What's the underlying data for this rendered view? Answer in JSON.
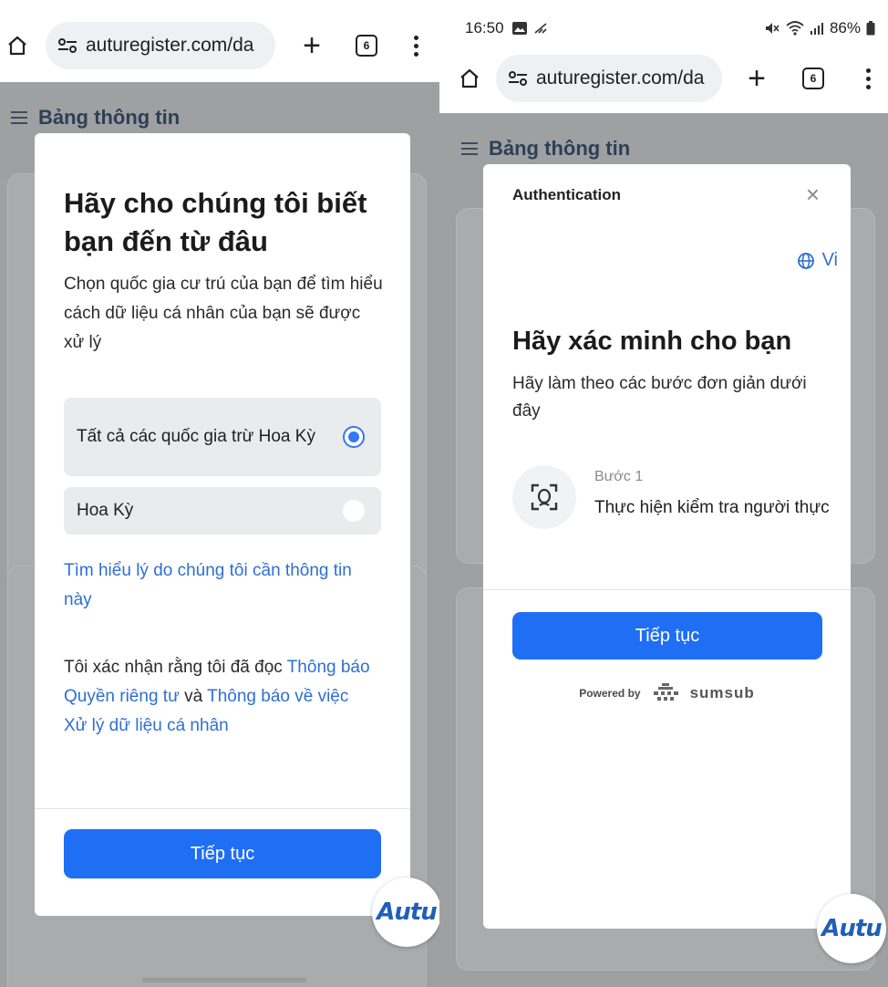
{
  "left": {
    "browser": {
      "url": "auturegister.com/da",
      "tab_count": "6"
    },
    "dashboard_title": "Bảng thông tin",
    "modal": {
      "title": "Hãy cho chúng tôi biết bạn đến từ đâu",
      "description": "Chọn quốc gia cư trú của bạn để tìm hiểu cách dữ liệu cá nhân của bạn sẽ được xử lý",
      "options": [
        {
          "label": "Tất cả các quốc gia trừ Hoa Kỳ",
          "selected": true
        },
        {
          "label": "Hoa Kỳ",
          "selected": false
        }
      ],
      "learn_link": "Tìm hiểu lý do chúng tôi cần thông tin này",
      "consent": {
        "prefix": "Tôi xác nhận rằng tôi đã đọc",
        "privacy_link": "Thông báo Quyền riêng tư",
        "and": "và",
        "processing_link": "Thông báo về việc Xử lý dữ liệu cá nhân"
      },
      "continue_label": "Tiếp tục"
    },
    "badge": "Autu"
  },
  "right": {
    "status": {
      "time": "16:50",
      "battery": "86%"
    },
    "browser": {
      "url": "auturegister.com/da",
      "tab_count": "6"
    },
    "dashboard_title": "Bảng thông tin",
    "modal": {
      "header": "Authentication",
      "close_icon": "×",
      "language": "Vi",
      "title": "Hãy xác minh cho bạn",
      "description": "Hãy làm theo các bước đơn giản dưới đây",
      "step_label": "Bước 1",
      "step_text": "Thực hiện kiểm tra người thực",
      "continue_label": "Tiếp tục",
      "powered_by": "Powered by",
      "provider": "sumsub"
    },
    "badge": "Autu"
  },
  "colors": {
    "accent": "#1f6ff5",
    "link": "#2f6fd1",
    "overlay": "#9ea0a2"
  }
}
